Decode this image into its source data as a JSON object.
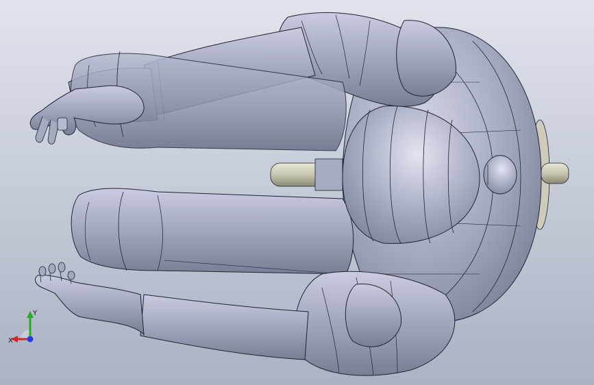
{
  "viewport": {
    "background_top": "#dfe3ec",
    "background_bottom": "#aab1c2",
    "model_color": "#9ea2b8",
    "edge_color": "#1f2230"
  },
  "model": {
    "name": ""
  },
  "triad": {
    "x_label": "X",
    "y_label": "Y",
    "x_color": "#e02020",
    "y_color": "#20b020",
    "z_color": "#2040e0"
  }
}
